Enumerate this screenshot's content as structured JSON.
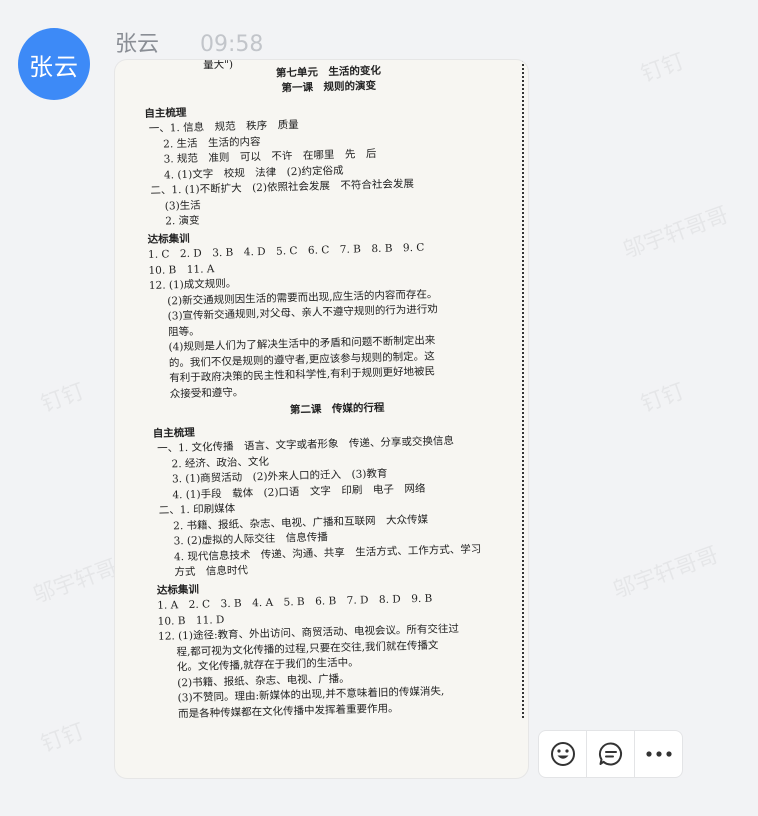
{
  "sender": {
    "avatar_text": "张云",
    "name": "张云",
    "time": "09:58"
  },
  "watermark": {
    "texts": [
      "钉钉",
      "邬宇轩哥哥"
    ]
  },
  "document": {
    "top_fragment": "量大\")",
    "unit_title": "第七单元　生活的变化",
    "lesson1_title": "第一课　规则的演变",
    "section1": "自主梳理",
    "l1": [
      "一、1. 信息　规范　秩序　质量",
      "2. 生活　生活的内容",
      "3. 规范　准则　可以　不许　在哪里　先　后",
      "4. (1)文字　校规　法律　(2)约定俗成",
      "二、1. (1)不断扩大　(2)依照社会发展　不符合社会发展",
      "(3)生活",
      "2. 演变"
    ],
    "section2": "达标集训",
    "l2": [
      "1. C　2. D　3. B　4. D　5. C　6. C　7. B　8. B　9. C",
      "10. B　11. A",
      "12. (1)成文规则。",
      "(2)新交通规则因生活的需要而出现,应生活的内容而存在。",
      "(3)宣传新交通规则,对父母、亲人不遵守规则的行为进行劝",
      "阻等。",
      "(4)规则是人们为了解决生活中的矛盾和问题不断制定出来",
      "的。我们不仅是规则的遵守者,更应该参与规则的制定。这",
      "有利于政府决策的民主性和科学性,有利于规则更好地被民",
      "众接受和遵守。"
    ],
    "lesson2_title": "第二课　传媒的行程",
    "section3": "自主梳理",
    "l3": [
      "一、1. 文化传播　语言、文字或者形象　传递、分享或交换信息",
      "2. 经济、政治、文化",
      "3. (1)商贸活动　(2)外来人口的迁入　(3)教育",
      "4. (1)手段　载体　(2)口语　文字　印刷　电子　网络",
      "二、1. 印刷媒体",
      "2. 书籍、报纸、杂志、电视、广播和互联网　大众传媒",
      "3. (2)虚拟的人际交往　信息传播",
      "4. 现代信息技术　传递、沟通、共享　生活方式、工作方式、学习",
      "方式　信息时代"
    ],
    "section4": "达标集训",
    "l4": [
      "1. A　2. C　3. B　4. A　5. B　6. B　7. D　8. D　9. B",
      "10. B　11. D",
      "12. (1)途径:教育、外出访问、商贸活动、电视会议。所有交往过",
      "程,都可视为文化传播的过程,只要在交往,我们就在传播文",
      "化。文化传播,就存在于我们的生活中。",
      "(2)书籍、报纸、杂志、电视、广播。",
      "(3)不赞同。理由:新媒体的出现,并不意味着旧的传媒消失,",
      "而是各种传媒都在文化传播中发挥着重要作用。"
    ]
  },
  "reactions": [
    {
      "icon": "smile-icon"
    },
    {
      "icon": "comment-icon"
    },
    {
      "icon": "more-icon"
    }
  ]
}
